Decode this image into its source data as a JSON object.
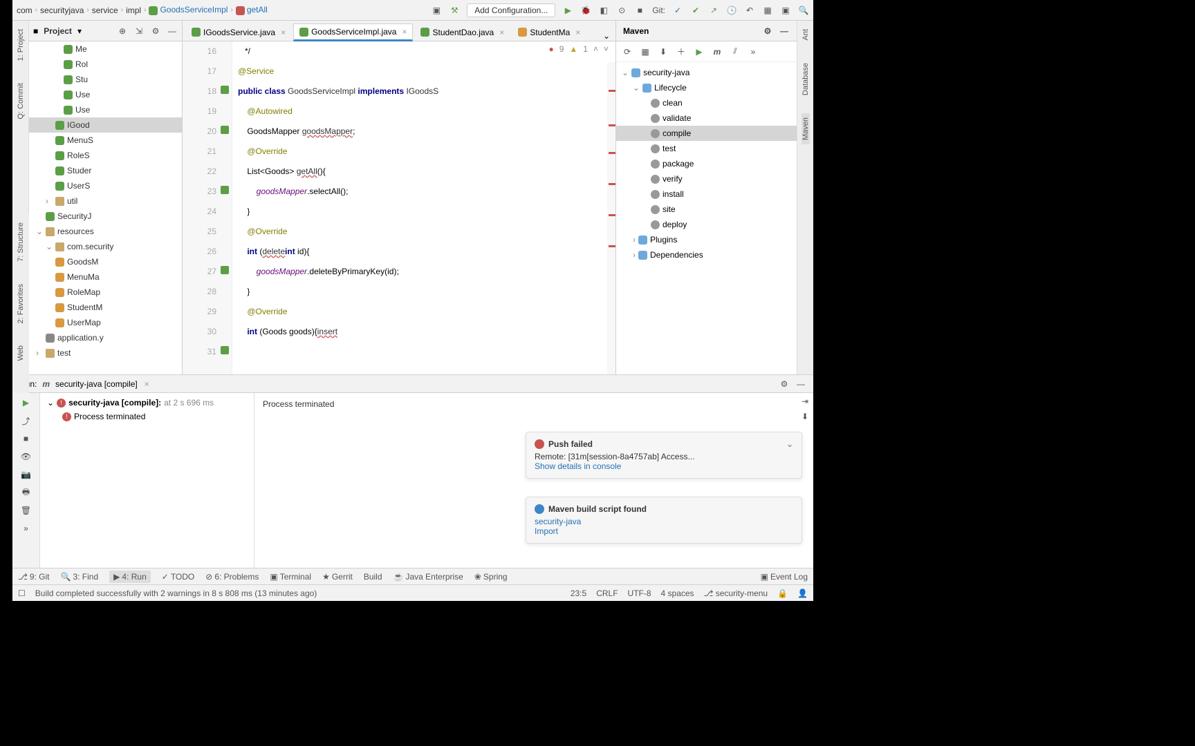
{
  "breadcrumbs": [
    "com",
    "securityjava",
    "service",
    "impl"
  ],
  "breadcrumb_class": "GoodsServiceImpl",
  "breadcrumb_method": "getAll",
  "add_config": "Add Configuration...",
  "git_label": "Git:",
  "project": {
    "title": "Project",
    "items": [
      {
        "label": "Me",
        "ico": "c",
        "pad": 50
      },
      {
        "label": "Rol",
        "ico": "c",
        "pad": 50
      },
      {
        "label": "Stu",
        "ico": "c",
        "pad": 50
      },
      {
        "label": "Use",
        "ico": "c",
        "pad": 50
      },
      {
        "label": "Use",
        "ico": "c",
        "pad": 50
      },
      {
        "label": "IGood",
        "ico": "c",
        "pad": 38,
        "sel": true
      },
      {
        "label": "MenuS",
        "ico": "c",
        "pad": 38
      },
      {
        "label": "RoleS",
        "ico": "c",
        "pad": 38
      },
      {
        "label": "Studer",
        "ico": "c",
        "pad": 38
      },
      {
        "label": "UserS",
        "ico": "c",
        "pad": 38
      },
      {
        "label": "util",
        "ico": "folder",
        "pad": 24,
        "arrow": "›"
      },
      {
        "label": "SecurityJ",
        "ico": "c",
        "pad": 24
      },
      {
        "label": "resources",
        "ico": "folder",
        "pad": 10,
        "arrow": "⌄"
      },
      {
        "label": "com.security",
        "ico": "folder",
        "pad": 24,
        "arrow": "⌄"
      },
      {
        "label": "GoodsM",
        "ico": "orange",
        "pad": 38
      },
      {
        "label": "MenuMa",
        "ico": "orange",
        "pad": 38
      },
      {
        "label": "RoleMap",
        "ico": "orange",
        "pad": 38
      },
      {
        "label": "StudentM",
        "ico": "orange",
        "pad": 38
      },
      {
        "label": "UserMap",
        "ico": "orange",
        "pad": 38
      },
      {
        "label": "application.y",
        "ico": "yml",
        "pad": 24
      },
      {
        "label": "test",
        "ico": "folder",
        "pad": 10,
        "arrow": "›"
      }
    ]
  },
  "tabs": [
    {
      "label": "IGoodsService.java",
      "ico": "c"
    },
    {
      "label": "GoodsServiceImpl.java",
      "ico": "c",
      "active": true
    },
    {
      "label": "StudentDao.java",
      "ico": "c"
    },
    {
      "label": "StudentMa",
      "ico": "orange"
    }
  ],
  "editor_info": {
    "errors": "9",
    "warnings": "1"
  },
  "gutter": [
    "16",
    "17",
    "18",
    "19",
    "20",
    "21",
    "22",
    "23",
    "24",
    "25",
    "26",
    "27",
    "28",
    "29",
    "30",
    "31"
  ],
  "code_lines": [
    {
      "t": "   */"
    },
    {
      "ann": "@Service"
    },
    {
      "kw1": "public class ",
      "id1": "GoodsServiceImpl ",
      "kw2": "implements ",
      "id2": "IGoodsS"
    },
    {
      "ann": "    @Autowired"
    },
    {
      "t": "    GoodsMapper ",
      "err": "goodsMapper",
      "t2": ";"
    },
    {
      "t": ""
    },
    {
      "ann": "    @Override"
    },
    {
      "t": "    List<Goods> ",
      "err": "getAll",
      "t2": "(){"
    },
    {
      "field": "        goodsMapper",
      "t": ".selectAll();"
    },
    {
      "t": "    }"
    },
    {
      "ann": "    @Override"
    },
    {
      "kw1": "    int ",
      "err": "delete",
      "t": "(",
      "kw2": "int ",
      "t2": "id){"
    },
    {
      "field": "        goodsMapper",
      "t": ".deleteByPrimaryKey(id);"
    },
    {
      "t": "    }"
    },
    {
      "ann": "    @Override"
    },
    {
      "kw1": "    int ",
      "err": "insert",
      "t": "(Goods goods){"
    }
  ],
  "maven": {
    "title": "Maven",
    "root": "security-java",
    "lifecycle": "Lifecycle",
    "phases": [
      "clean",
      "validate",
      "compile",
      "test",
      "package",
      "verify",
      "install",
      "site",
      "deploy"
    ],
    "plugins": "Plugins",
    "deps": "Dependencies"
  },
  "run": {
    "label": "Run:",
    "config": "security-java [compile]",
    "node": "security-java [compile]:",
    "time": "at  2 s 696 ms",
    "term": "Process terminated",
    "output": "Process terminated"
  },
  "notif1": {
    "title": "Push failed",
    "body": "Remote:  [31m[session-8a4757ab] Access...",
    "link": "Show details in console"
  },
  "notif2": {
    "title": "Maven build script found",
    "body": "security-java",
    "link": "Import"
  },
  "tooltabs": [
    "9: Git",
    "3: Find",
    "4: Run",
    "TODO",
    "6: Problems",
    "Terminal",
    "Gerrit",
    "Build",
    "Java Enterprise",
    "Spring"
  ],
  "eventlog": "Event Log",
  "status": {
    "msg": "Build completed successfully with 2 warnings in 8 s 808 ms (13 minutes ago)",
    "pos": "23:5",
    "eol": "CRLF",
    "enc": "UTF-8",
    "indent": "4 spaces",
    "branch": "security-menu"
  },
  "left_labels": [
    "1: Project",
    "Q: Commit"
  ],
  "left_labels2": [
    "7: Structure",
    "2: Favorites",
    "Web"
  ],
  "right_labels": [
    "Ant",
    "Database",
    "Maven"
  ]
}
